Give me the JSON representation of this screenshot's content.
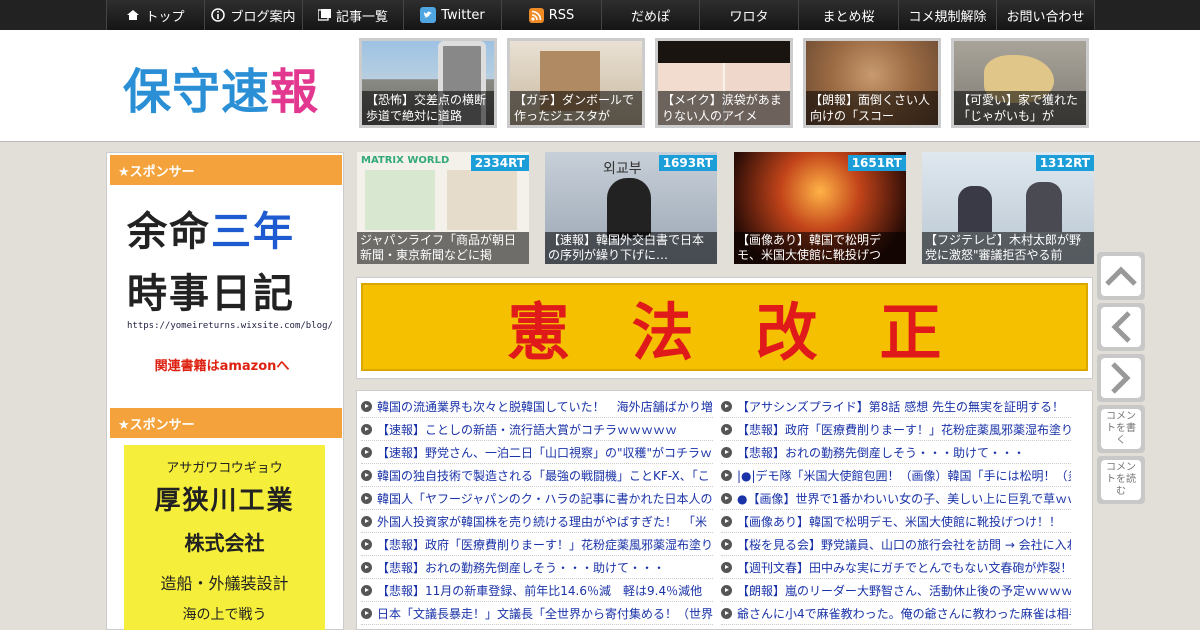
{
  "nav": {
    "top": "トップ",
    "blog_info": "ブログ案内",
    "articles": "記事一覧",
    "twitter": "Twitter",
    "rss": "RSS",
    "damebo": "だめぽ",
    "warota": "ワロタ",
    "matome": "まとめ桜",
    "comment_rule": "コメ規制解除",
    "contact": "お問い合わせ"
  },
  "logo": {
    "c1": "保",
    "c2": "守",
    "c3": "速",
    "c4": "報"
  },
  "header_thumbs": [
    {
      "caption": "【恐怖】交差点の横断歩道で絶対に道路"
    },
    {
      "caption": "【ガチ】ダンボールで作ったジェスタが"
    },
    {
      "caption": "【メイク】涙袋があまりない人のアイメ"
    },
    {
      "caption": "【朗報】面倒くさい人向けの「スコー"
    },
    {
      "caption": "【可愛い】家で獲れた「じゃがいも」が"
    }
  ],
  "sidebar": {
    "sponsor1": "★スポンサー",
    "sponsor2": "★スポンサー",
    "ad1": {
      "l1a": "余命",
      "l1b": "三年",
      "l2": "時事日記",
      "url": "https://yomeireturns.wixsite.com/blog/",
      "amazon": "関連書籍はamazonへ"
    },
    "ad2": {
      "kana": "アサガワコウギョウ",
      "name": "厚狭川工業",
      "corp": "株式会社",
      "desc": "造船・外艤装設計",
      "extra": "海の上で戦う"
    }
  },
  "rt_thumbs": [
    {
      "badge": "2334RT",
      "caption": "ジャパンライフ「商品が朝日新聞・東京新聞などに掲",
      "sub": "MATRIX WORLD"
    },
    {
      "badge": "1693RT",
      "caption": "【速報】韓国外交白書で日本の序列が繰り下げに…",
      "sub": "외교부"
    },
    {
      "badge": "1651RT",
      "caption": "【画像あり】韓国で松明デモ、米国大使館に靴投げつ"
    },
    {
      "badge": "1312RT",
      "caption": "【フジテレビ】木村太郎が野党に激怒\"審議拒否やる前"
    }
  ],
  "banner": {
    "c1": "憲",
    "c2": "法",
    "c3": "改",
    "c4": "正"
  },
  "list_left": [
    "韓国の流通業界も次々と脱韓国していた！　海外店舗ばかり増",
    "【速報】ことしの新語・流行語大賞がコチラｗｗｗｗｗ",
    "【速報】野党さん、一泊二日「山口視察」の\"収穫\"がコチラｗ",
    "韓国の独自技術で製造される「最強の戦闘機」ことKF-X、「こ",
    "韓国人「ヤフージャパンのク・ハラの記事に書かれた日本人の",
    "外国人投資家が韓国株を売り続ける理由がやばすぎた！　「米",
    "【悲報】政府「医療費削りまーす！」花粉症薬風邪薬湿布塗り",
    "【悲報】おれの勤務先倒産しそう・・・助けて・・・",
    "【悲報】11月の新車登録、前年比14.6％減　軽は9.4％減他",
    "日本「文議長暴走！」文議長「全世界から寄付集める！（世界"
  ],
  "list_right": [
    "【アサシンズプライド】第8話 感想 先生の無実を証明する！",
    "【悲報】政府「医療費削りまーす！」花粉症薬風邪薬湿布塗り",
    "【悲報】おれの勤務先倒産しそう・・・助けて・・・",
    "|●|デモ隊「米国大使館包囲！（画像）韓国「手には松明！（炎",
    "●【画像】世界で1番かわいい女の子、美しい上に巨乳で草ｗｗ",
    "【画像あり】韓国で松明デモ、米国大使館に靴投げつけ！！",
    "【桜を見る会】野党議員、山口の旅行会社を訪問 → 会社に入れ",
    "【週刊文春】田中みな実にガチでとんでもない文春砲が炸裂！",
    "【朗報】嵐のリーダー大野智さん、活動休止後の予定ｗｗｗｗ",
    "爺さんに小4で麻雀教わった。俺の爺さんに教わった麻雀は相手"
  ],
  "side_buttons": {
    "comment_write": "コメントを書く",
    "comment_read": "コメントを読む"
  },
  "colors": {
    "accent_orange": "#f4a33c",
    "rt_badge": "#1c9ed9",
    "banner_yellow": "#f5c000",
    "banner_red": "#e01a1a",
    "link_blue": "#1a33a8"
  }
}
